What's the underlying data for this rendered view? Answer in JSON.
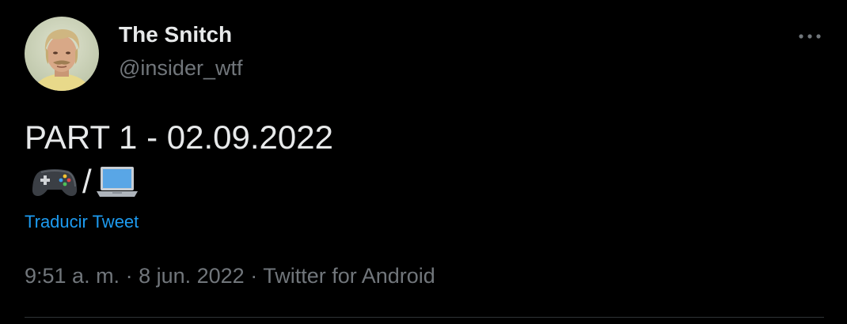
{
  "author": {
    "display_name": "The Snitch",
    "handle": "@insider_wtf",
    "avatar_icon": "profile-photo"
  },
  "tweet": {
    "text": "PART 1 - 02.09.2022",
    "emojis": [
      "video-game-controller-emoji",
      "laptop-emoji"
    ],
    "emoji_separator": "/",
    "translate_label": "Traducir Tweet"
  },
  "meta": {
    "time": "9:51 a. m.",
    "separator1": " · ",
    "date": "8 jun. 2022",
    "separator2": " · ",
    "source": "Twitter for Android"
  },
  "menu": {
    "more_icon": "more-options-icon"
  },
  "colors": {
    "background": "#000000",
    "primary_text": "#e7e9ea",
    "secondary_text": "#71767b",
    "link": "#1d9bf0",
    "divider": "#2f3336"
  }
}
